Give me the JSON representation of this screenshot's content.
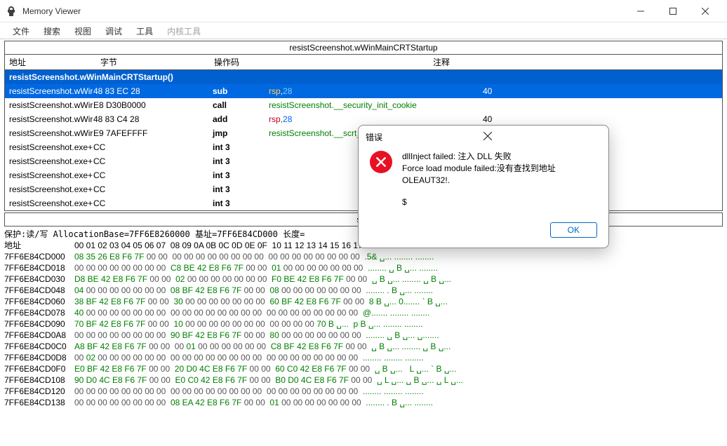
{
  "window": {
    "title": "Memory Viewer"
  },
  "menu": {
    "file": "文件",
    "search": "搜索",
    "view": "视图",
    "debug": "调试",
    "tools": "工具",
    "kernel": "内核工具"
  },
  "header_bar": "resistScreenshot.wWinMainCRTStartup",
  "columns": {
    "addr": "地址",
    "bytes": "字节",
    "opcode": "操作码",
    "note": "注释"
  },
  "disasm": {
    "func_header": "resistScreenshot.wWinMainCRTStartup()",
    "rows": [
      {
        "addr": "resistScreenshot.wWir",
        "bytes": "48 83 EC 28",
        "mnemo": "sub",
        "arg_reg": "rsp",
        "arg_sep": ",",
        "arg_imm": "28",
        "note": "40",
        "sel": true
      },
      {
        "addr": "resistScreenshot.wWir",
        "bytes": "E8 D30B0000",
        "mnemo": "call",
        "arg_call": "resistScreenshot.__security_init_cookie",
        "note": ""
      },
      {
        "addr": "resistScreenshot.wWir",
        "bytes": "48 83 C4 28",
        "mnemo": "add",
        "arg_reg": "rsp",
        "arg_sep": ",",
        "arg_imm": "28",
        "note": "40"
      },
      {
        "addr": "resistScreenshot.wWir",
        "bytes": "E9 7AFEFFFF",
        "mnemo": "jmp",
        "arg_call": "resistScreenshot.__scrt_c",
        "note": ""
      },
      {
        "addr": "resistScreenshot.exe+",
        "bytes": "CC",
        "mnemo": "int 3",
        "note": ""
      },
      {
        "addr": "resistScreenshot.exe+",
        "bytes": "CC",
        "mnemo": "int 3",
        "note": ""
      },
      {
        "addr": "resistScreenshot.exe+",
        "bytes": "CC",
        "mnemo": "int 3",
        "note": ""
      },
      {
        "addr": "resistScreenshot.exe+",
        "bytes": "CC",
        "mnemo": "int 3",
        "note": ""
      },
      {
        "addr": "resistScreenshot.exe+",
        "bytes": "CC",
        "mnemo": "int 3",
        "note": ""
      }
    ]
  },
  "mid_bar": "sub",
  "hex": {
    "info": "保护:读/写  AllocationBase=7FF6E8260000  基址=7FF6E84CD000 长度=",
    "addr_label": "地址",
    "offsets": "00 01 02 03 04 05 06 07  08 09 0A 0B 0C 0D 0E 0F  10 11 12 13 14 15 16 17  01234567 89ABCDEF 01234567",
    "rows": [
      {
        "a": "7FF6E84CD000",
        "b": "08 35 26 E8 F6 7F 00 00  00 00 00 00 00 00 00 00  00 00 00 00 00 00 00 00",
        "t": ".5& ␣... ........ ........"
      },
      {
        "a": "7FF6E84CD018",
        "b": "00 00 00 00 00 00 00 00  C8 BE 42 E8 F6 7F 00 00  01 00 00 00 00 00 00 00",
        "t": "........ ␣ B ␣... ........"
      },
      {
        "a": "7FF6E84CD030",
        "b": "D8 BE 42 E8 F6 7F 00 00  02 00 00 00 00 00 00 00  F0 BE 42 E8 F6 7F 00 00",
        "t": "␣ B ␣... ........ ␣ B ␣..."
      },
      {
        "a": "7FF6E84CD048",
        "b": "04 00 00 00 00 00 00 00  08 BF 42 E8 F6 7F 00 00  08 00 00 00 00 00 00 00",
        "t": "........ . B ␣... ........"
      },
      {
        "a": "7FF6E84CD060",
        "b": "38 BF 42 E8 F6 7F 00 00  30 00 00 00 00 00 00 00  60 BF 42 E8 F6 7F 00 00",
        "t": "8 B ␣... 0....... ` B ␣..."
      },
      {
        "a": "7FF6E84CD078",
        "b": "40 00 00 00 00 00 00 00  00 00 00 00 00 00 00 00  00 00 00 00 00 00 00 00",
        "t": "@....... ........ ........"
      },
      {
        "a": "7FF6E84CD090",
        "b": "70 BF 42 E8 F6 7F 00 00  10 00 00 00 00 00 00 00  00 00 00 00 70 B ␣...",
        "t": "p B ␣... ........ ........"
      },
      {
        "a": "7FF6E84CD0A8",
        "b": "00 00 00 00 00 00 00 00  90 BF 42 E8 F6 7F 00 00  80 00 00 00 00 00 00 00",
        "t": "........ ␣ B ␣... ␣......."
      },
      {
        "a": "7FF6E84CD0C0",
        "b": "A8 BF 42 E8 F6 7F 00 00  00 01 00 00 00 00 00 00  C8 BF 42 E8 F6 7F 00 00",
        "t": "␣ B ␣... ........ ␣ B ␣..."
      },
      {
        "a": "7FF6E84CD0D8",
        "b": "00 02 00 00 00 00 00 00  00 00 00 00 00 00 00 00  00 00 00 00 00 00 00 00",
        "t": "........ ........ ........"
      },
      {
        "a": "7FF6E84CD0F0",
        "b": "E0 BF 42 E8 F6 7F 00 00  20 D0 4C E8 F6 7F 00 00  60 C0 42 E8 F6 7F 00 00",
        "t": "␣ B ␣...   L ␣... ` B ␣..."
      },
      {
        "a": "7FF6E84CD108",
        "b": "90 D0 4C E8 F6 7F 00 00  E0 C0 42 E8 F6 7F 00 00  B0 D0 4C E8 F6 7F 00 00",
        "t": "␣ L ␣... ␣ B ␣... ␣ L ␣..."
      },
      {
        "a": "7FF6E84CD120",
        "b": "00 00 00 00 00 00 00 00  00 00 00 00 00 00 00 00  00 00 00 00 00 00 00 00",
        "t": "........ ........ ........"
      },
      {
        "a": "7FF6E84CD138",
        "b": "00 00 00 00 00 00 00 00  08 EA 42 E8 F6 7F 00 00  01 00 00 00 00 00 00 00",
        "t": "........ . B ␣... ........"
      }
    ]
  },
  "dialog": {
    "title": "错误",
    "line1": "dllInject failed: 注入 DLL 失败",
    "line2": "Force load module failed:没有查找到地址",
    "line3": "OLEAUT32!.",
    "line4": "$",
    "ok": "OK"
  }
}
